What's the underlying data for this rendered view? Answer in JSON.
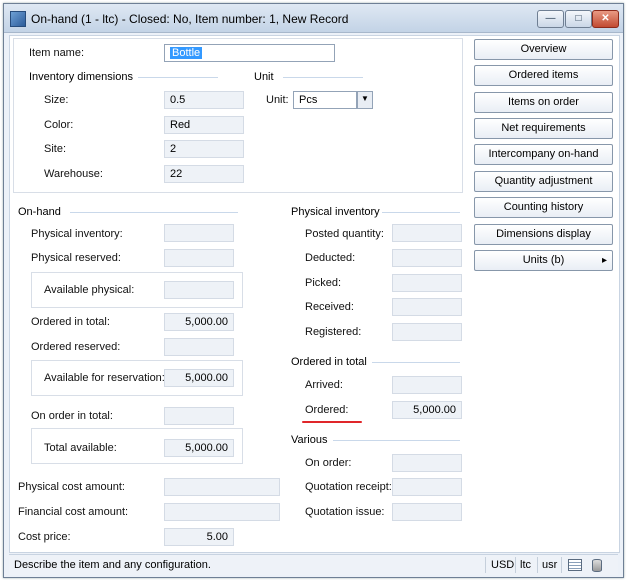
{
  "window": {
    "title": "On-hand (1 - ltc) - Closed: No, Item number: 1, New Record",
    "minimize_label": "—",
    "maximize_label": "□",
    "close_label": "✕"
  },
  "item": {
    "label": "Item name:",
    "value": "Bottle"
  },
  "inventory_dimensions": {
    "title": "Inventory dimensions",
    "size": {
      "label": "Size:",
      "value": "0.5"
    },
    "color": {
      "label": "Color:",
      "value": "Red"
    },
    "site": {
      "label": "Site:",
      "value": "2"
    },
    "warehouse": {
      "label": "Warehouse:",
      "value": "22"
    }
  },
  "unit": {
    "title": "Unit",
    "label": "Unit:",
    "value": "Pcs",
    "arrow": "▼"
  },
  "onhand": {
    "title": "On-hand",
    "physical_inventory": {
      "label": "Physical inventory:",
      "value": ""
    },
    "physical_reserved": {
      "label": "Physical reserved:",
      "value": ""
    },
    "available_physical": {
      "label": "Available physical:",
      "value": ""
    },
    "ordered_in_total": {
      "label": "Ordered in total:",
      "value": "5,000.00"
    },
    "ordered_reserved": {
      "label": "Ordered reserved:",
      "value": ""
    },
    "available_for_reservation": {
      "label": "Available for reservation:",
      "value": "5,000.00"
    },
    "on_order_in_total": {
      "label": "On order in total:",
      "value": ""
    },
    "total_available": {
      "label": "Total available:",
      "value": "5,000.00"
    },
    "physical_cost_amount": {
      "label": "Physical cost amount:",
      "value": ""
    },
    "financial_cost_amount": {
      "label": "Financial cost amount:",
      "value": ""
    },
    "cost_price": {
      "label": "Cost price:",
      "value": "5.00"
    }
  },
  "physical_inventory": {
    "title": "Physical inventory",
    "posted_quantity": {
      "label": "Posted quantity:",
      "value": ""
    },
    "deducted": {
      "label": "Deducted:",
      "value": ""
    },
    "picked": {
      "label": "Picked:",
      "value": ""
    },
    "received": {
      "label": "Received:",
      "value": ""
    },
    "registered": {
      "label": "Registered:",
      "value": ""
    }
  },
  "ordered_total": {
    "title": "Ordered in total",
    "arrived": {
      "label": "Arrived:",
      "value": ""
    },
    "ordered": {
      "label": "Ordered:",
      "value": "5,000.00"
    }
  },
  "various": {
    "title": "Various",
    "on_order": {
      "label": "On order:",
      "value": ""
    },
    "quotation_receipt": {
      "label": "Quotation receipt:",
      "value": ""
    },
    "quotation_issue": {
      "label": "Quotation issue:",
      "value": ""
    }
  },
  "buttons": {
    "overview": "Overview",
    "ordered_items": "Ordered items",
    "items_on_order": "Items on order",
    "net_requirements": "Net requirements",
    "intercompany_onhand": "Intercompany on-hand",
    "quantity_adjustment": "Quantity adjustment",
    "counting_history": "Counting history",
    "dimensions_display": "Dimensions display",
    "units_b": "Units (b)",
    "units_arrow": "▸"
  },
  "status": {
    "message": "Describe the item and any configuration.",
    "currency": "USD",
    "company": "ltc",
    "layer": "usr"
  },
  "colors": {
    "accent_underline": "#e0262a",
    "selection": "#3399ff"
  }
}
